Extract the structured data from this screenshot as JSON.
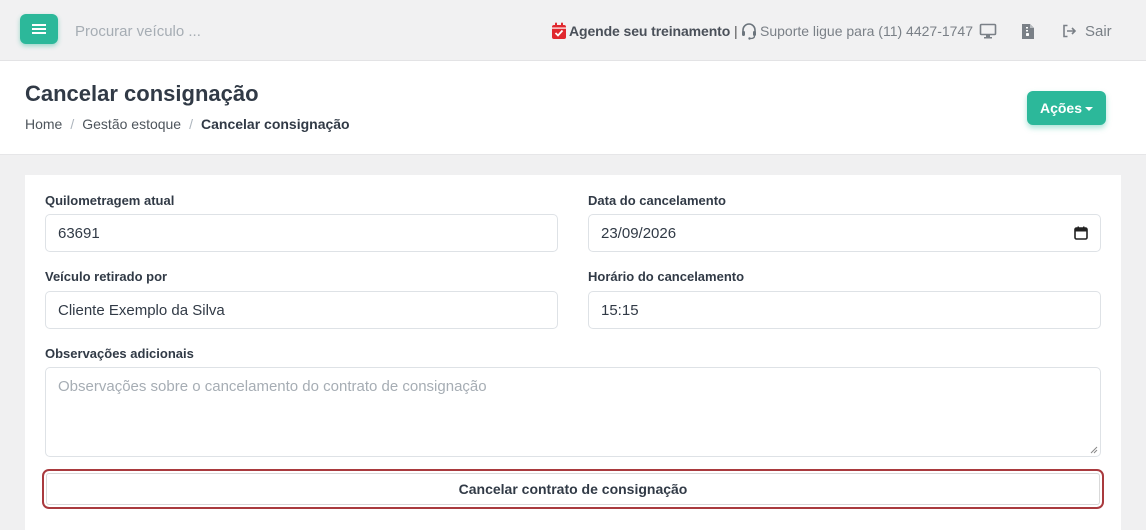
{
  "topbar": {
    "search_placeholder": "Procurar veículo ...",
    "training_label": "Agende seu treinamento",
    "separator": "|",
    "support_label": "Suporte ligue para (11) 4427-1747",
    "logout_label": "Sair",
    "icons": [
      "menu-icon",
      "calendar-check-icon",
      "headset-icon",
      "monitor-icon",
      "document-icon",
      "logout-icon"
    ]
  },
  "header": {
    "title": "Cancelar consignação",
    "breadcrumb": [
      "Home",
      "Gestão estoque",
      "Cancelar consignação"
    ],
    "breadcrumb_separator": "/",
    "actions_label": "Ações"
  },
  "form": {
    "mileage": {
      "label": "Quilometragem atual",
      "value": "63691"
    },
    "cancel_date": {
      "label": "Data do cancelamento",
      "value": "23/09/2026"
    },
    "withdrawn_by": {
      "label": "Veículo retirado por",
      "value": "Cliente Exemplo da Silva"
    },
    "cancel_time": {
      "label": "Horário do cancelamento",
      "value": "15:15"
    },
    "notes": {
      "label": "Observações adicionais",
      "placeholder": "Observações sobre o cancelamento do contrato de consignação",
      "value": ""
    },
    "submit_label": "Cancelar contrato de consignação"
  },
  "colors": {
    "primary": "#2cb89a",
    "danger_border": "#a93a3e",
    "calendar_red": "#e0282e",
    "text_dark": "#313a46",
    "background": "#f0f0f1"
  }
}
